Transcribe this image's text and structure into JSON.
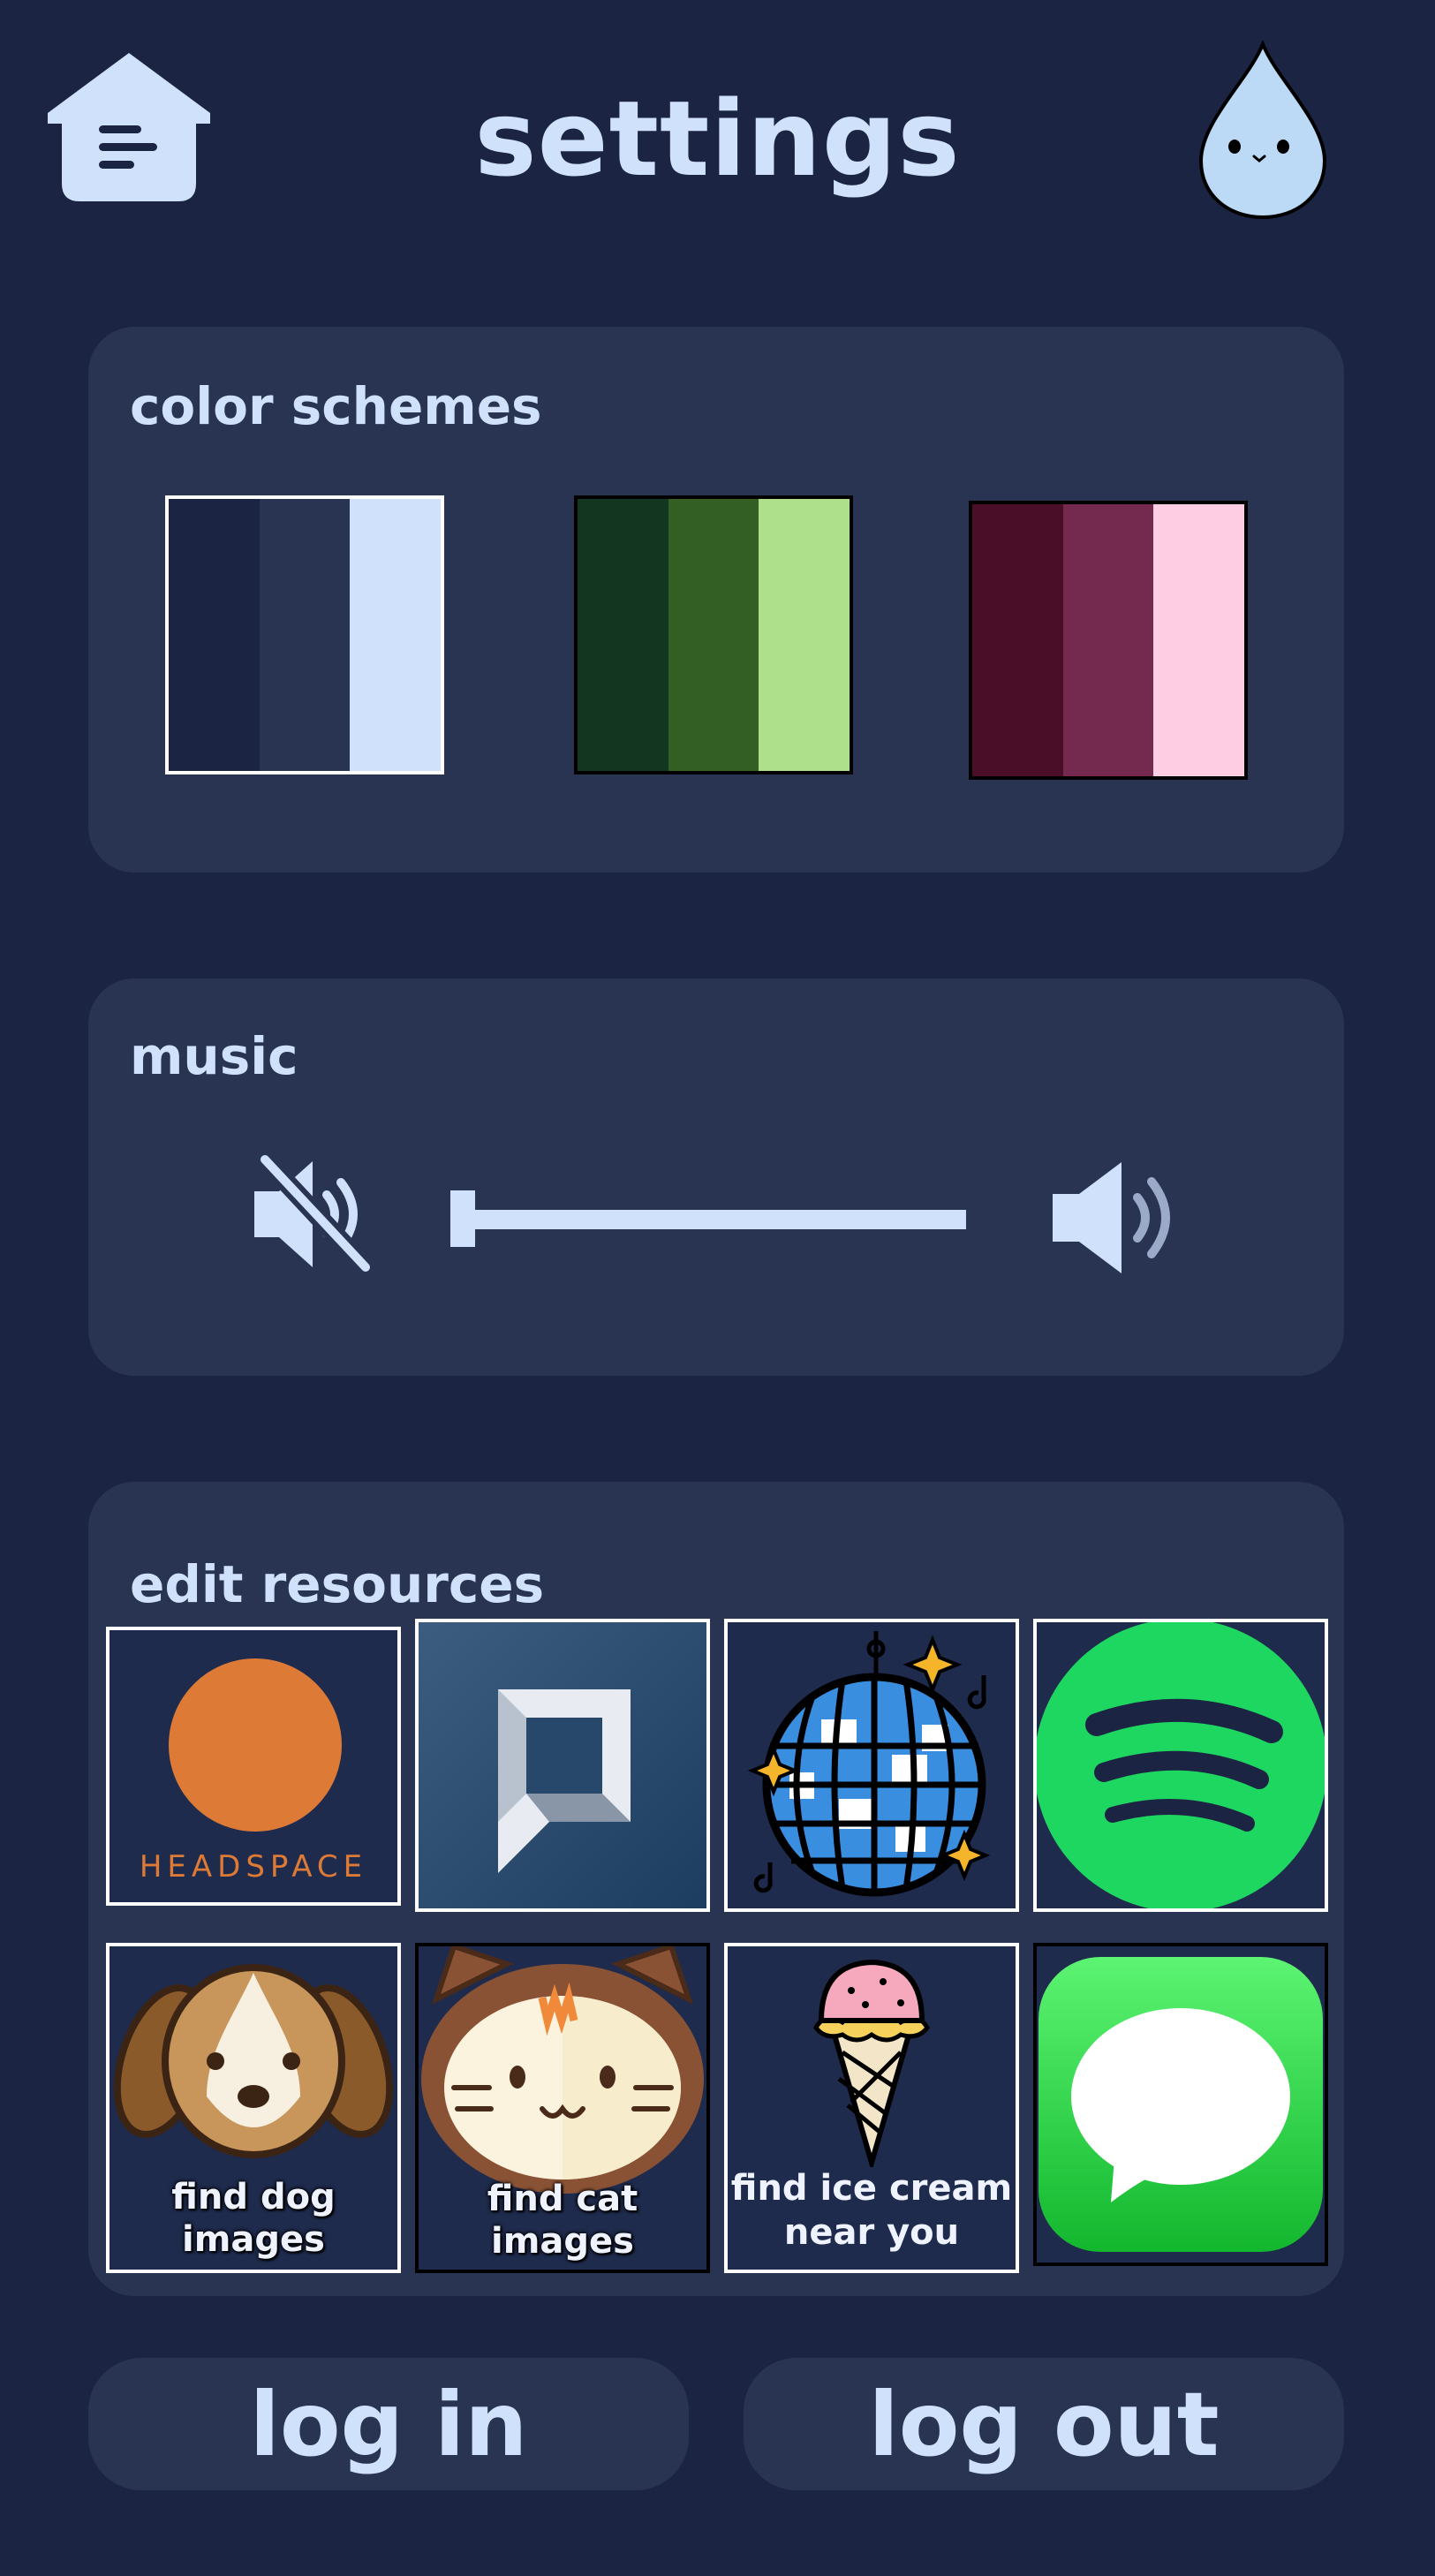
{
  "header": {
    "title": "settings",
    "home_icon": "home-menu-icon",
    "mascot_icon": "water-drop-mascot-icon"
  },
  "color_schemes": {
    "title": "color schemes",
    "schemes": [
      {
        "name": "blue",
        "colors": [
          "#1b2442",
          "#283452",
          "#cfe1fb"
        ],
        "selected": true
      },
      {
        "name": "green",
        "colors": [
          "#12361f",
          "#345f24",
          "#aee08b"
        ],
        "selected": false
      },
      {
        "name": "pink",
        "colors": [
          "#4b0e29",
          "#742a4f",
          "#ffcde3"
        ],
        "selected": false
      }
    ]
  },
  "music": {
    "title": "music",
    "mute_icon": "speaker-muted-icon",
    "volume_icon": "speaker-volume-icon",
    "volume_level": 0
  },
  "resources": {
    "title": "edit resources",
    "items": [
      {
        "name": "headspace",
        "label": "HEADSPACE"
      },
      {
        "name": "square-app",
        "label": ""
      },
      {
        "name": "disco-ball",
        "label": ""
      },
      {
        "name": "spotify",
        "label": ""
      },
      {
        "name": "find-dog-images",
        "label_line1": "find dog",
        "label_line2": "images"
      },
      {
        "name": "find-cat-images",
        "label_line1": "find cat",
        "label_line2": "images"
      },
      {
        "name": "find-ice-cream",
        "label_line1": "find ice cream",
        "label_line2": "near you"
      },
      {
        "name": "messages",
        "label": ""
      }
    ]
  },
  "actions": {
    "login_label": "log in",
    "logout_label": "log out"
  },
  "colors": {
    "background": "#1b2442",
    "panel": "#283452",
    "accent": "#cfe1fb"
  }
}
